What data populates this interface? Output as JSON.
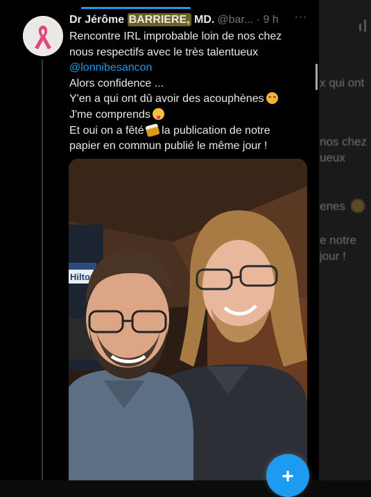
{
  "tweet": {
    "author_name_prefix": "Dr Jérôme ",
    "author_name_highlight": "BARRIERE,",
    "author_name_suffix": " MD.",
    "handle": "@bar...",
    "separator": " · ",
    "time": "9 h",
    "lines": {
      "l1": "Rencontre IRL improbable loin de nos chez",
      "l2": "nous respectifs avec le très talentueux",
      "mention": "@lonnibesancon",
      "l4": "Alors confidence ...",
      "l5": "Y'en a qui ont dû avoir des acouphènes",
      "l6": "J'me comprends",
      "l7a": "Et oui on a fêté",
      "l7b": " la publication de notre",
      "l8": "papier en commun publié le même jour !"
    },
    "photo_sign": "Hilton"
  },
  "background": {
    "g1": "x qui ont",
    "g2": "nos chez",
    "g3": "ueux",
    "g4": "enes",
    "g5": "e notre",
    "g6": "jour !"
  },
  "icons": {
    "more": "more-icon",
    "compose": "plus-icon"
  },
  "colors": {
    "accent": "#1d9bf0",
    "highlight": "#6e6126"
  }
}
